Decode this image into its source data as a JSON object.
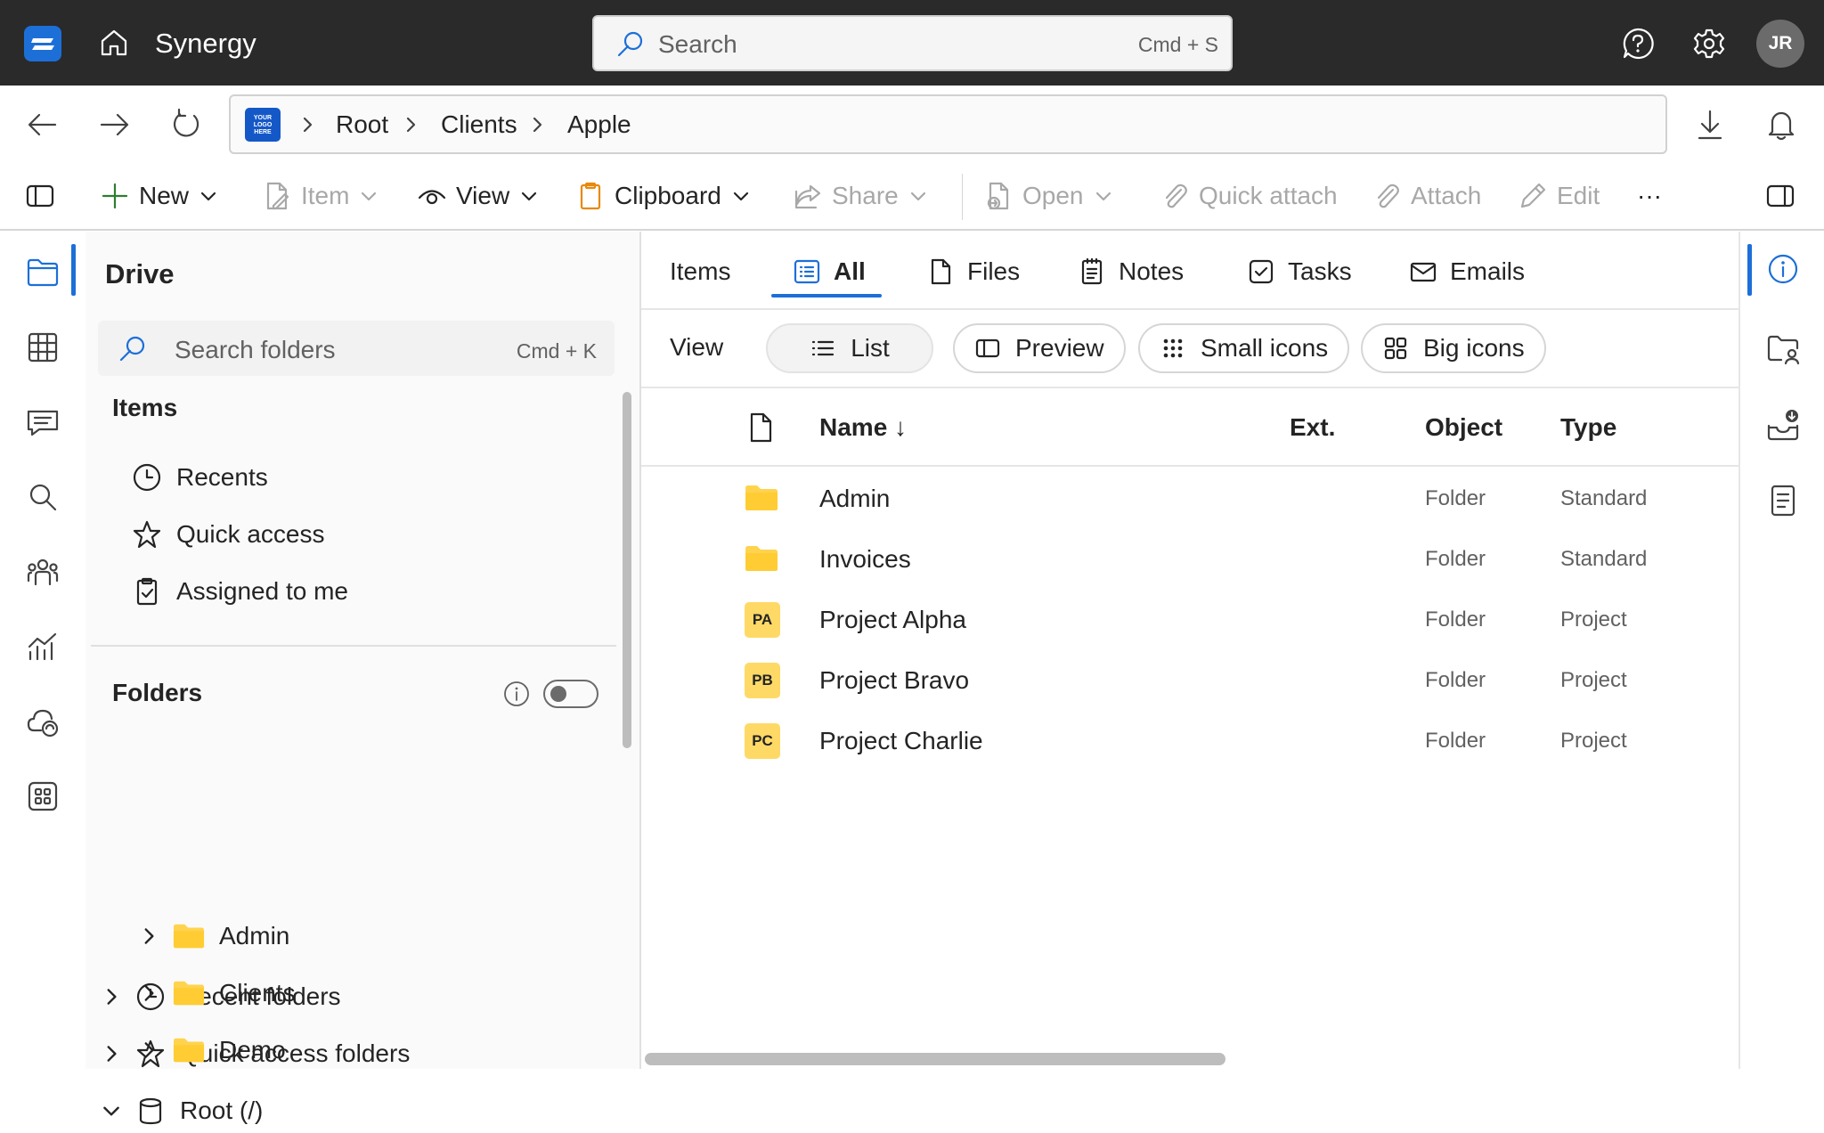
{
  "app": {
    "title": "Synergy"
  },
  "search": {
    "placeholder": "Search",
    "shortcut": "Cmd + S"
  },
  "user": {
    "initials": "JR"
  },
  "breadcrumb": {
    "logo_text": "YOUR LOGO HERE",
    "items": [
      "Root",
      "Clients",
      "Apple"
    ]
  },
  "commands": {
    "new": "New",
    "item": "Item",
    "view": "View",
    "clipboard": "Clipboard",
    "share": "Share",
    "open": "Open",
    "quick_attach": "Quick attach",
    "attach": "Attach",
    "edit": "Edit",
    "more": "···"
  },
  "sidebar": {
    "title": "Drive",
    "search_placeholder": "Search folders",
    "search_shortcut": "Cmd + K",
    "items_heading": "Items",
    "items": [
      "Recents",
      "Quick access",
      "Assigned to me"
    ],
    "folders_heading": "Folders",
    "folders": [
      "Recent folders",
      "Quick access folders",
      "Root (/)"
    ],
    "root_children": [
      "Admin",
      "Clients",
      "Demo"
    ]
  },
  "tabs": {
    "label": "Items",
    "items": [
      "All",
      "Files",
      "Notes",
      "Tasks",
      "Emails"
    ]
  },
  "view_modes": {
    "label": "View",
    "items": [
      "List",
      "Preview",
      "Small icons",
      "Big icons"
    ]
  },
  "table": {
    "columns": {
      "name": "Name ↓",
      "ext": "Ext.",
      "object": "Object",
      "type": "Type"
    },
    "rows": [
      {
        "badge": "",
        "name": "Admin",
        "object": "Folder",
        "type": "Standard"
      },
      {
        "badge": "",
        "name": "Invoices",
        "object": "Folder",
        "type": "Standard"
      },
      {
        "badge": "PA",
        "name": "Project Alpha",
        "object": "Folder",
        "type": "Project"
      },
      {
        "badge": "PB",
        "name": "Project Bravo",
        "object": "Folder",
        "type": "Project"
      },
      {
        "badge": "PC",
        "name": "Project Charlie",
        "object": "Folder",
        "type": "Project"
      }
    ]
  },
  "colors": {
    "accent": "#1d6fd8",
    "topbar": "#2a2a2a",
    "folder": "#ffd34d",
    "badge": "#ffd966"
  }
}
